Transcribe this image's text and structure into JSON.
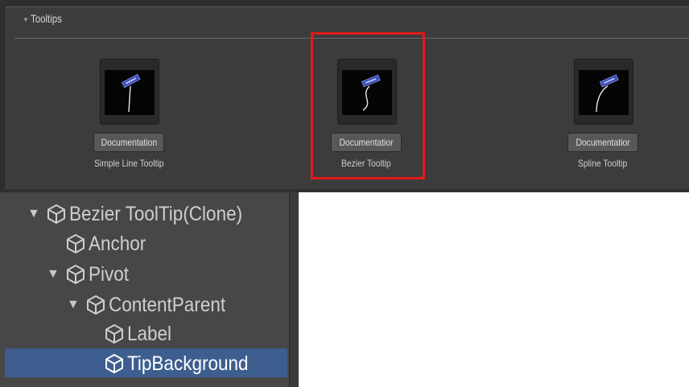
{
  "tooltips_panel": {
    "title": "Tooltips",
    "items": [
      {
        "button_label": "Documentation",
        "label": "Simple Line Tooltip",
        "thumb_icon": "straight-line-tooltip-preview"
      },
      {
        "button_label": "Documentatior",
        "label": "Bezier Tooltip",
        "thumb_icon": "bezier-curve-tooltip-preview"
      },
      {
        "button_label": "Documentatior",
        "label": "Spline Tooltip",
        "thumb_icon": "spline-curve-tooltip-preview"
      }
    ],
    "highlight_color": "#e21b1b",
    "highlighted_item": "Bezier Tooltip"
  },
  "hierarchy": {
    "rows": [
      {
        "label": "Bezier ToolTip(Clone)",
        "expanded": true,
        "has_arrow": true
      },
      {
        "label": "Anchor",
        "expanded": false,
        "has_arrow": false
      },
      {
        "label": "Pivot",
        "expanded": true,
        "has_arrow": true
      },
      {
        "label": "ContentParent",
        "expanded": true,
        "has_arrow": true
      },
      {
        "label": "Label",
        "expanded": false,
        "has_arrow": false
      },
      {
        "label": "TipBackground",
        "expanded": false,
        "has_arrow": false,
        "selected": true
      }
    ],
    "selected_color": "#3d5e8f"
  },
  "colors": {
    "panel_bg": "#3c3c3c",
    "hierarchy_bg": "#474747",
    "thumb_bg": "#050505",
    "tooltip_box": "#3e4fb8"
  }
}
